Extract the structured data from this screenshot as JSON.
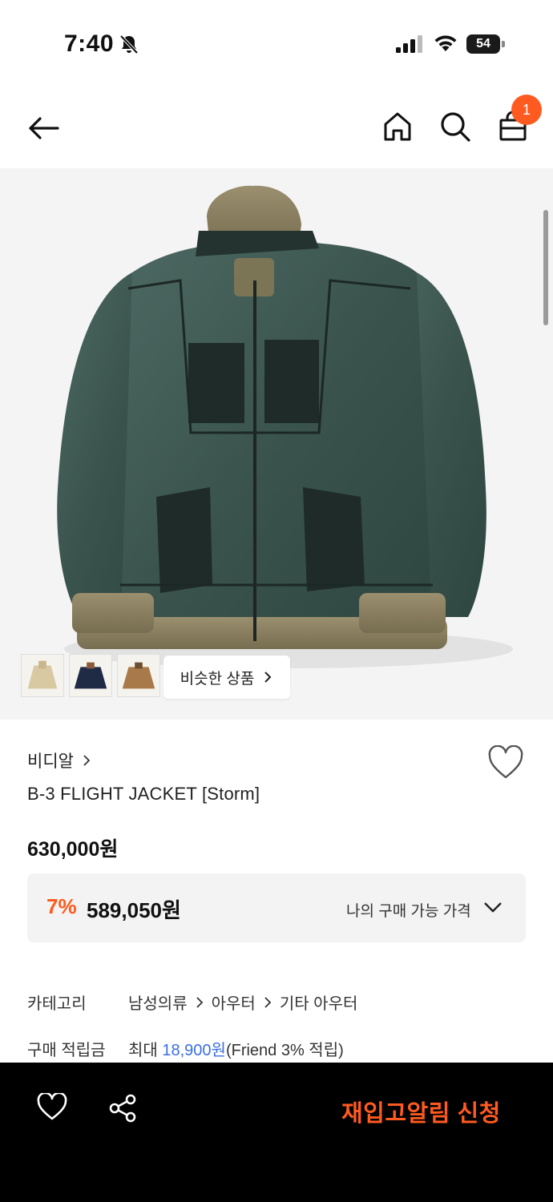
{
  "status_bar": {
    "time": "7:40",
    "battery": "54"
  },
  "header": {
    "cart_count": "1",
    "icons": [
      "back-arrow-icon",
      "home-icon",
      "search-icon",
      "shopping-bag-icon"
    ]
  },
  "gallery": {
    "similar_label": "비슷한 상품",
    "thumbnails": [
      "beige-jacket",
      "navy-jacket",
      "brown-jacket"
    ]
  },
  "product": {
    "brand": "비디알",
    "title": "B-3 FLIGHT JACKET [Storm]",
    "original_price": "630,000원",
    "discount_rate": "7%",
    "sale_price": "589,050원",
    "my_price_label": "나의 구매 가능 가격"
  },
  "details": {
    "category_label": "카테고리",
    "category_path": [
      "남성의류",
      "아우터",
      "기타 아우터"
    ],
    "points_label": "구매 적립금",
    "points_prefix": "최대 ",
    "points_value": "18,900원",
    "points_suffix": "(Friend 3% 적립)"
  },
  "bottom_bar": {
    "restock_label": "재입고알림 신청"
  },
  "colors": {
    "accent": "#ff5a1f",
    "link": "#3b6fe0",
    "bottom_bar_bg": "#000000",
    "jacket_suede": "#3d5650",
    "jacket_fur": "#8a8062"
  }
}
